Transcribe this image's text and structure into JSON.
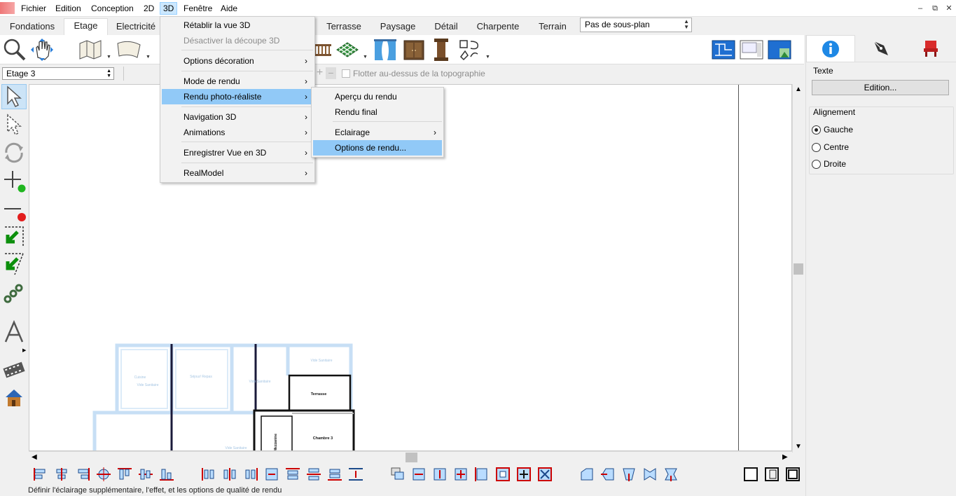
{
  "menubar": {
    "items": [
      "Fichier",
      "Edition",
      "Conception",
      "2D",
      "3D",
      "Fenêtre",
      "Aide"
    ],
    "active": "3D"
  },
  "tabs": [
    "Fondations",
    "Etage",
    "Electricité",
    "Terrasse",
    "Paysage",
    "Détail",
    "Charpente",
    "Terrain"
  ],
  "subplan": "Pas de sous-plan",
  "floor": {
    "selected": "Etage 3",
    "float_label": "Flotter au-dessus de la topographie"
  },
  "menu3d": {
    "items": [
      {
        "label": "Rétablir la vue 3D",
        "enabled": true,
        "submenu": false
      },
      {
        "label": "Désactiver la découpe 3D",
        "enabled": false,
        "submenu": false
      },
      {
        "label": "Options décoration",
        "enabled": true,
        "submenu": true
      },
      {
        "label": "Mode de rendu",
        "enabled": true,
        "submenu": true
      },
      {
        "label": "Rendu photo-réaliste",
        "enabled": true,
        "submenu": true,
        "highlighted": true
      },
      {
        "label": "Navigation 3D",
        "enabled": true,
        "submenu": true
      },
      {
        "label": "Animations",
        "enabled": true,
        "submenu": true
      },
      {
        "label": "Enregistrer Vue en 3D",
        "enabled": true,
        "submenu": true
      },
      {
        "label": "RealModel",
        "enabled": true,
        "submenu": true
      }
    ]
  },
  "submenu_render": {
    "items": [
      {
        "label": "Aperçu du rendu",
        "submenu": false
      },
      {
        "label": "Rendu final",
        "submenu": false
      },
      {
        "label": "Eclairage",
        "submenu": true
      },
      {
        "label": "Options de rendu...",
        "submenu": false,
        "highlighted": true
      }
    ]
  },
  "plan_labels": {
    "terrasse": "Terrasse",
    "chambre": "Chambre 3",
    "mezzanine": "Mezzanine",
    "cuisine": "Cuisine",
    "sejour": "Séjour/ Repas",
    "vide_sanitaire": "Vide Sanitaire"
  },
  "rightpanel": {
    "text_group": "Texte",
    "edit_button": "Edition...",
    "align_group": "Alignement",
    "align_options": [
      "Gauche",
      "Centre",
      "Droite"
    ],
    "align_selected": "Gauche"
  },
  "status": "Définir l'éclairage supplémentaire, l'effet, et les options de qualité de rendu",
  "colors": {
    "highlight": "#91c9f7",
    "menu_active": "#cce8ff",
    "info_blue": "#1e88e5",
    "plan_light": "#c7dff5"
  }
}
